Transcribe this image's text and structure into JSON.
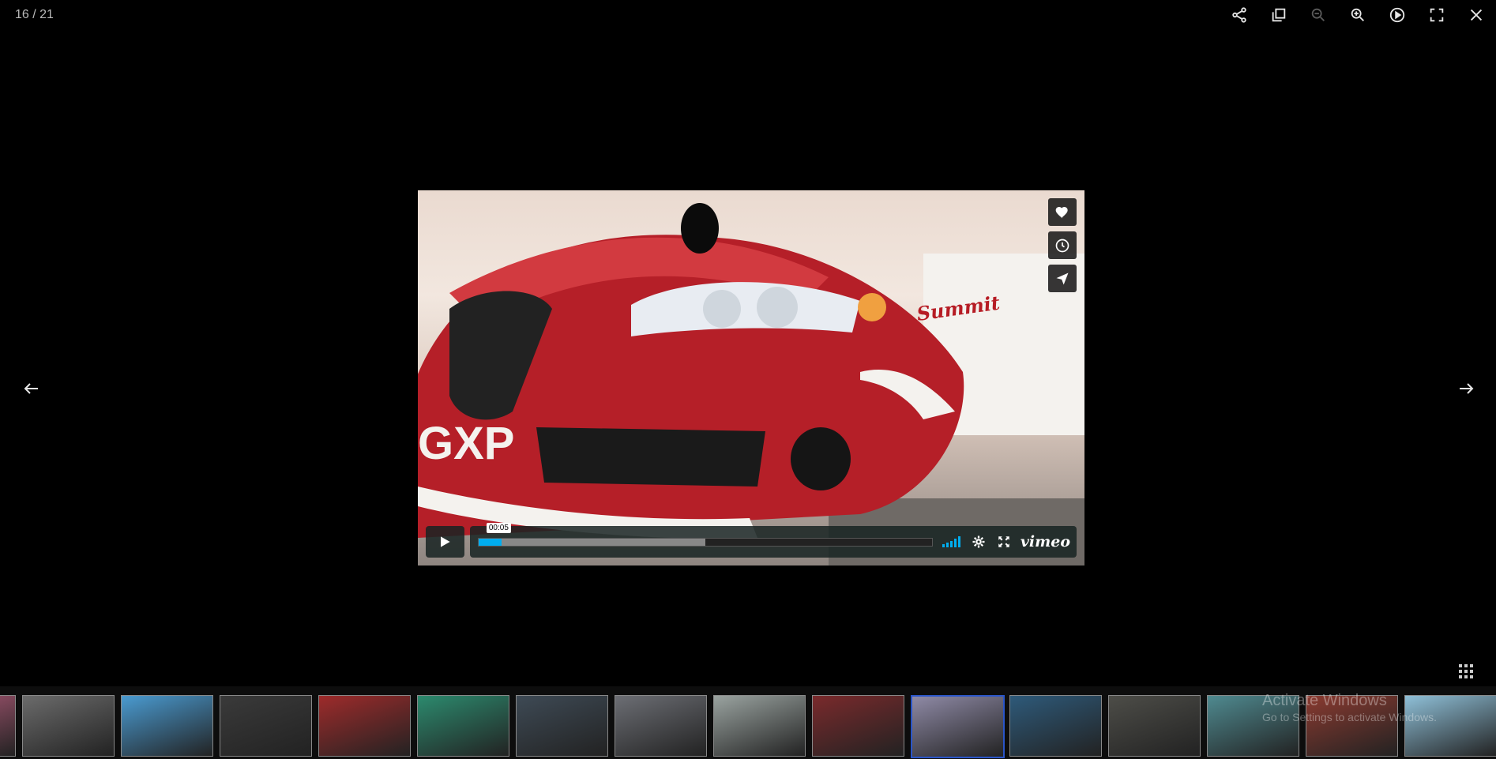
{
  "counter": "16 / 21",
  "toolbar": {
    "buttons": [
      {
        "name": "share-icon",
        "enabled": true
      },
      {
        "name": "copy-icon",
        "enabled": true
      },
      {
        "name": "zoom-out-icon",
        "enabled": false
      },
      {
        "name": "zoom-in-icon",
        "enabled": true
      },
      {
        "name": "autoplay-icon",
        "enabled": true
      },
      {
        "name": "fullscreen-icon",
        "enabled": true
      },
      {
        "name": "close-icon",
        "enabled": true
      }
    ]
  },
  "video": {
    "time_tooltip": "00:05",
    "progress_played": 0.05,
    "progress_loaded": 0.5,
    "brand": "vimeo",
    "plate_text": "GXP",
    "sign_text": "Summit",
    "side_buttons": [
      "heart-icon",
      "clock-icon",
      "send-icon"
    ]
  },
  "thumbnails": [
    {
      "color": "#b05a78",
      "active": false
    },
    {
      "color": "#6b6b6b",
      "active": false
    },
    {
      "color": "#4a9bd1",
      "active": false
    },
    {
      "color": "#3a3a3a",
      "active": false
    },
    {
      "color": "#9e2b2b",
      "active": false
    },
    {
      "color": "#2c8a6e",
      "active": false
    },
    {
      "color": "#3e4a55",
      "active": false
    },
    {
      "color": "#6c6e74",
      "active": false
    },
    {
      "color": "#9aa3a0",
      "active": false
    },
    {
      "color": "#7a2a2c",
      "active": false
    },
    {
      "color": "#8f8aa6",
      "active": true
    },
    {
      "color": "#2e5a7a",
      "active": false
    },
    {
      "color": "#4d4d48",
      "active": false
    },
    {
      "color": "#4f8a90",
      "active": false
    },
    {
      "color": "#8a3a30",
      "active": false
    },
    {
      "color": "#8fc0d8",
      "active": false
    }
  ],
  "watermark": {
    "line1": "Activate Windows",
    "line2": "Go to Settings to activate Windows."
  }
}
